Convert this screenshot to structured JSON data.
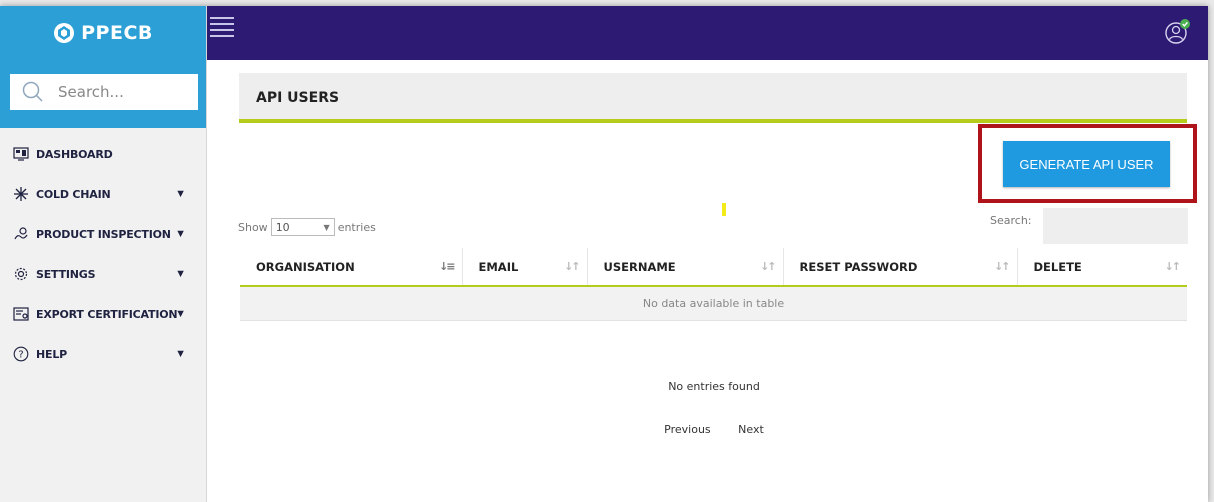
{
  "brand": {
    "name": "PPECB"
  },
  "sidebar": {
    "search_placeholder": "Search...",
    "items": [
      {
        "label": "DASHBOARD",
        "icon": "dashboard-icon",
        "has_arrow": false
      },
      {
        "label": "COLD CHAIN",
        "icon": "snowflake-icon",
        "has_arrow": true
      },
      {
        "label": "PRODUCT INSPECTION",
        "icon": "inspection-icon",
        "has_arrow": true
      },
      {
        "label": "SETTINGS",
        "icon": "gear-icon",
        "has_arrow": true
      },
      {
        "label": "EXPORT CERTIFICATION",
        "icon": "certificate-icon",
        "has_arrow": true
      },
      {
        "label": "HELP",
        "icon": "help-icon",
        "has_arrow": true
      }
    ],
    "arrow": "▼"
  },
  "page": {
    "title": "API USERS",
    "generate_button": "GENERATE API USER",
    "show_label": "Show",
    "entries_value": "10",
    "entries_label": "entries",
    "search_label": "Search:",
    "search_value": ""
  },
  "table": {
    "columns": [
      "ORGANISATION",
      "EMAIL",
      "USERNAME",
      "RESET PASSWORD",
      "DELETE"
    ],
    "empty_message": "No data available in table"
  },
  "footer": {
    "no_entries": "No entries found",
    "previous": "Previous",
    "next": "Next"
  },
  "colors": {
    "topbar": "#2d1a72",
    "brand_blue": "#2b9fd6",
    "accent_green": "#b5cc1b",
    "button_blue": "#1f9ae0",
    "highlight_red": "#b0141b"
  }
}
